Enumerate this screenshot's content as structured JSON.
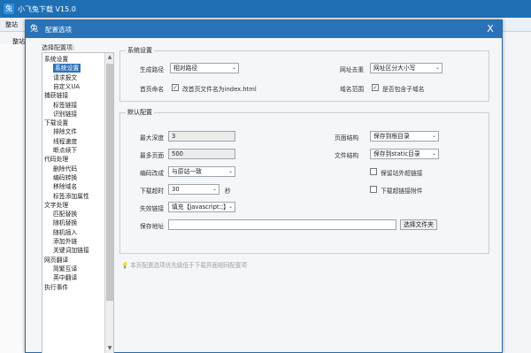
{
  "app": {
    "title": "小飞兔下载 V15.0",
    "logo": "兔",
    "toolbar_item": "整站",
    "tab": "整站图"
  },
  "dialog": {
    "title": "配置选项",
    "icon": "兔",
    "close": "X",
    "select_label": "选择配置项:"
  },
  "tree": {
    "items": [
      {
        "label": "系统设置",
        "level": 0
      },
      {
        "label": "系统设置",
        "level": 1,
        "selected": true
      },
      {
        "label": "请求报文",
        "level": 1
      },
      {
        "label": "自定义UA",
        "level": 1
      },
      {
        "label": "捕获链接",
        "level": 0
      },
      {
        "label": "标签链接",
        "level": 1
      },
      {
        "label": "识别链接",
        "level": 1
      },
      {
        "label": "下载设置",
        "level": 0
      },
      {
        "label": "排除文件",
        "level": 1
      },
      {
        "label": "线程速度",
        "level": 1
      },
      {
        "label": "断点续下",
        "level": 1
      },
      {
        "label": "代码处理",
        "level": 0
      },
      {
        "label": "删除代码",
        "level": 1
      },
      {
        "label": "编码转换",
        "level": 1
      },
      {
        "label": "移除域名",
        "level": 1
      },
      {
        "label": "标签添加属性",
        "level": 1
      },
      {
        "label": "文字处理",
        "level": 0
      },
      {
        "label": "匹配替换",
        "level": 1
      },
      {
        "label": "随机替换",
        "level": 1
      },
      {
        "label": "随机插入",
        "level": 1
      },
      {
        "label": "添加外链",
        "level": 1
      },
      {
        "label": "关键词加链接",
        "level": 1
      },
      {
        "label": "网页翻译",
        "level": 0
      },
      {
        "label": "简繁互译",
        "level": 1
      },
      {
        "label": "英中翻译",
        "level": 1
      },
      {
        "label": "执行事件",
        "level": 0
      }
    ]
  },
  "system": {
    "group_title": "系统设置",
    "gen_path_label": "生成路径",
    "gen_path_value": "相对路径",
    "url_dedupe_label": "网址去重",
    "url_dedupe_value": "网址区分大小写",
    "homepage_label": "首页命名",
    "homepage_check": "改首页文件名为index.html",
    "domain_label": "域名范围",
    "domain_check": "是否包含子域名"
  },
  "defaults": {
    "group_title": "默认配置",
    "max_depth_label": "最大深度",
    "max_depth_value": "3",
    "page_struct_label": "页面结构",
    "page_struct_value": "保存到根目录",
    "max_pages_label": "最多页面",
    "max_pages_value": "500",
    "file_struct_label": "文件结构",
    "file_struct_value": "保存到static目录",
    "encoding_label": "编码改成",
    "encoding_value": "与原站一致",
    "keep_external_check": "保留站外超链接",
    "timeout_label": "下载超时",
    "timeout_value": "30",
    "timeout_unit": "秒",
    "download_attach_check": "下载超链接附件",
    "invalid_link_label": "失效链接",
    "invalid_link_value": "填充【javascript:;】",
    "save_addr_label": "保存地址",
    "save_addr_value": "",
    "choose_folder_button": "选择文件夹"
  },
  "tip": "本页配置选项优先级低于下载界面相同配置项"
}
